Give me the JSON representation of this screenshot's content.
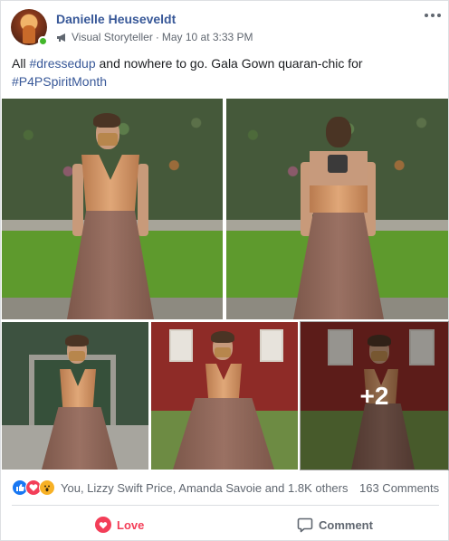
{
  "post": {
    "author": "Danielle Heuseveldt",
    "role": "Visual Storyteller",
    "separator": "·",
    "timestamp": "May 10 at 3:33 PM",
    "text_before": "All ",
    "hashtag1": "#dressedup",
    "text_middle": " and nowhere to go. Gala Gown quaran-chic for ",
    "hashtag2": "#P4PSpiritMonth",
    "more_photos_label": "+2"
  },
  "reactions": {
    "icons": [
      "like-icon",
      "love-icon",
      "wow-icon"
    ],
    "summary": "You, Lizzy Swift Price, Amanda Savoie and 1.8K others",
    "comments": "163 Comments"
  },
  "actions": {
    "love_label": "Love",
    "comment_label": "Comment"
  },
  "colors": {
    "link": "#385898",
    "love": "#f33e58",
    "like": "#1877f2",
    "wow": "#f7b125",
    "online": "#42b72a"
  }
}
